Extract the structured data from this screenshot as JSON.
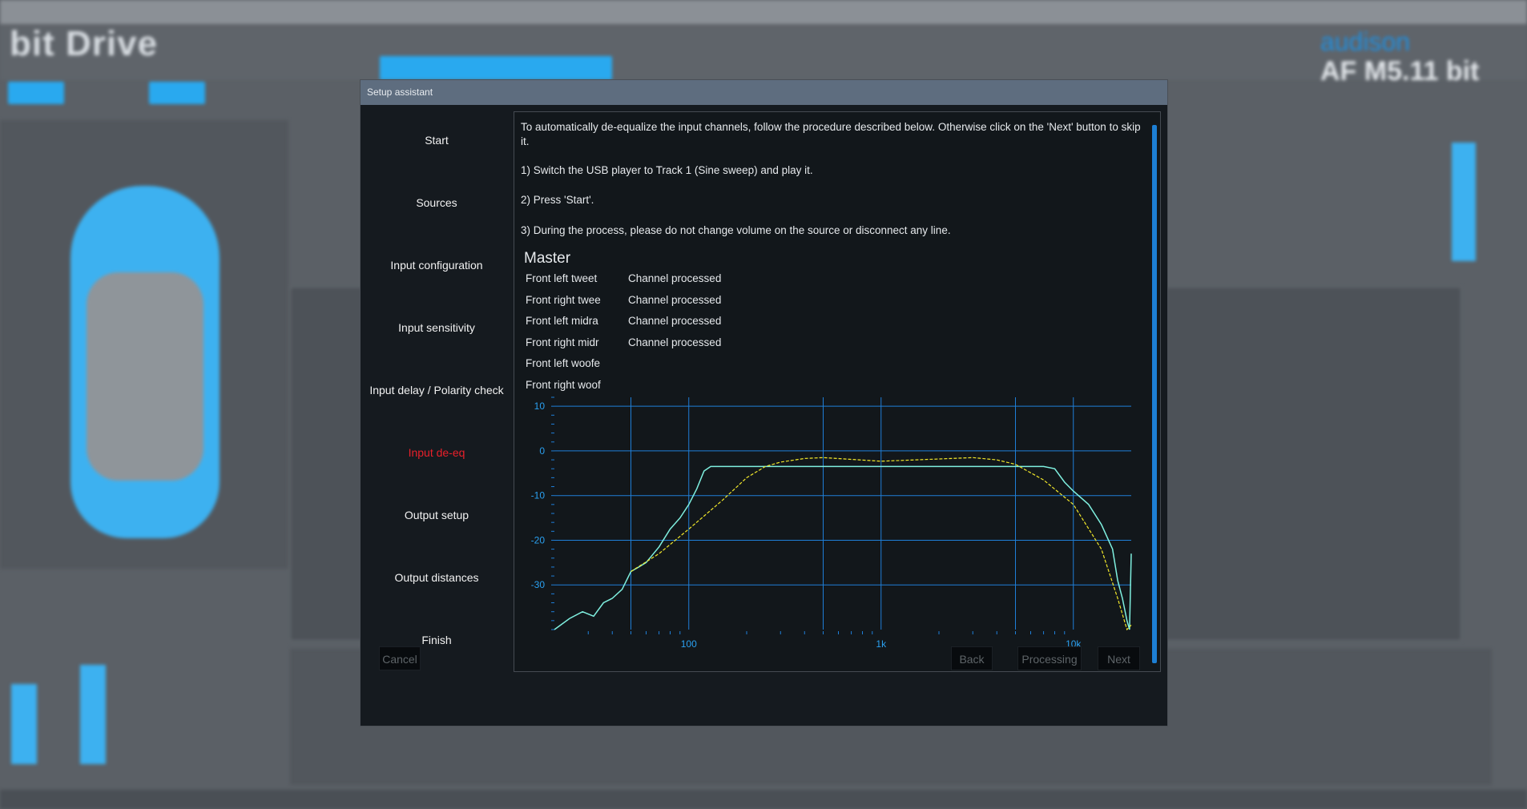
{
  "modal": {
    "title": "Setup assistant"
  },
  "steps": [
    {
      "label": "Start",
      "active": false
    },
    {
      "label": "Sources",
      "active": false
    },
    {
      "label": "Input configuration",
      "active": false
    },
    {
      "label": "Input sensitivity",
      "active": false
    },
    {
      "label": "Input delay / Polarity check",
      "active": false
    },
    {
      "label": "Input de-eq",
      "active": true
    },
    {
      "label": "Output setup",
      "active": false
    },
    {
      "label": "Output distances",
      "active": false
    },
    {
      "label": "Finish",
      "active": false
    }
  ],
  "instructions": {
    "intro": "To automatically de-equalize the input channels, follow the procedure described below. Otherwise click on the 'Next' button to skip it.",
    "step1": "1) Switch the USB player to Track 1 (Sine sweep) and play it.",
    "step2": "2) Press 'Start'.",
    "step3": "3) During the process, please do not change volume on the source or disconnect any line."
  },
  "master": {
    "title": "Master",
    "channels": [
      {
        "name": "Front left tweet",
        "status": "Channel processed"
      },
      {
        "name": "Front right twee",
        "status": "Channel processed"
      },
      {
        "name": "Front left midra",
        "status": "Channel processed"
      },
      {
        "name": "Front right midr",
        "status": "Channel processed"
      },
      {
        "name": "Front left woofe",
        "status": ""
      },
      {
        "name": "Front right woof",
        "status": ""
      }
    ]
  },
  "footer": {
    "cancel": "Cancel",
    "back": "Back",
    "processing": "Processing",
    "next": "Next"
  },
  "background": {
    "logo": "bit Drive",
    "brand": "audison",
    "model": "AF M5.11 bit"
  },
  "colors": {
    "accent": "#29a9ef",
    "active_step": "#e8202a",
    "measured_curve": "#7ff0e0",
    "target_curve": "#f2e82a",
    "grid": "#1f7fd8"
  },
  "chart_data": {
    "type": "line",
    "x_scale": "log",
    "xlim": [
      20,
      20000
    ],
    "ylim": [
      -40,
      12
    ],
    "x_ticks": [
      {
        "value": 100,
        "label": "100"
      },
      {
        "value": 1000,
        "label": "1k"
      },
      {
        "value": 10000,
        "label": "10k"
      }
    ],
    "y_ticks": [
      {
        "value": 10,
        "label": "10"
      },
      {
        "value": 0,
        "label": "0"
      },
      {
        "value": -10,
        "label": "-10"
      },
      {
        "value": -20,
        "label": "-20"
      },
      {
        "value": -30,
        "label": "-30"
      }
    ],
    "grid": true,
    "series": [
      {
        "key": "measured",
        "x": [
          20,
          24,
          28,
          32,
          36,
          40,
          45,
          50,
          55,
          60,
          70,
          80,
          90,
          100,
          110,
          120,
          130,
          150,
          200,
          300,
          500,
          700,
          1000,
          2000,
          3000,
          5000,
          7000,
          8000,
          9000,
          10000,
          12000,
          14000,
          16000,
          17000,
          18000,
          19000,
          19600,
          20000
        ],
        "y": [
          -40,
          -37.5,
          -36,
          -37,
          -34,
          -33,
          -31,
          -27,
          -26,
          -25,
          -21.5,
          -17.5,
          -15,
          -12,
          -8.5,
          -4.5,
          -3.5,
          -3.5,
          -3.5,
          -3.5,
          -3.5,
          -3.5,
          -3.5,
          -3.5,
          -3.5,
          -3.5,
          -3.5,
          -4,
          -7,
          -9,
          -12,
          -16.5,
          -22,
          -29,
          -33,
          -38,
          -40,
          -23
        ]
      },
      {
        "key": "target",
        "x": [
          50,
          70,
          100,
          150,
          200,
          250,
          300,
          400,
          500,
          700,
          1000,
          2000,
          3000,
          4000,
          5000,
          7000,
          10000,
          14000,
          17000,
          19000,
          20000
        ],
        "y": [
          -27,
          -23,
          -17.5,
          -11,
          -6,
          -3.5,
          -2.5,
          -1.7,
          -1.5,
          -1.9,
          -2.3,
          -1.8,
          -1.5,
          -2,
          -3,
          -6.5,
          -12,
          -22,
          -33,
          -40,
          -39
        ]
      }
    ]
  }
}
